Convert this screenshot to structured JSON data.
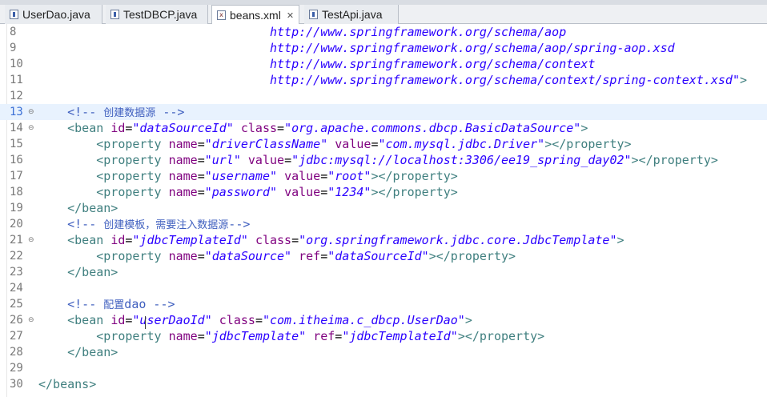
{
  "tabs": [
    {
      "label": "UserDao.java",
      "icon": "java-file-icon",
      "active": false
    },
    {
      "label": "TestDBCP.java",
      "icon": "java-file-icon",
      "active": false
    },
    {
      "label": "beans.xml",
      "icon": "xml-file-icon",
      "active": true,
      "close": "✕"
    },
    {
      "label": "TestApi.java",
      "icon": "java-file-icon",
      "active": false
    }
  ],
  "editor": {
    "lines": [
      {
        "n": "8",
        "fold": "",
        "seg": [
          [
            "t",
            "                                "
          ],
          [
            "v",
            "http://www.springframework.org/schema/aop"
          ]
        ]
      },
      {
        "n": "9",
        "fold": "",
        "seg": [
          [
            "t",
            "                                "
          ],
          [
            "v",
            "http://www.springframework.org/schema/aop/spring-aop.xsd"
          ]
        ]
      },
      {
        "n": "10",
        "fold": "",
        "seg": [
          [
            "t",
            "                                "
          ],
          [
            "v",
            "http://www.springframework.org/schema/context"
          ]
        ]
      },
      {
        "n": "11",
        "fold": "",
        "seg": [
          [
            "t",
            "                                "
          ],
          [
            "v",
            "http://www.springframework.org/schema/context/spring-context.xsd\""
          ],
          [
            "g",
            ">"
          ]
        ]
      },
      {
        "n": "12",
        "fold": "",
        "seg": []
      },
      {
        "n": "13",
        "fold": "⊖",
        "current": true,
        "seg": [
          [
            "t",
            "    "
          ],
          [
            "c",
            "<!-- "
          ],
          [
            "z",
            "创建数据源"
          ],
          [
            "c",
            " -->"
          ]
        ]
      },
      {
        "n": "14",
        "fold": "⊖",
        "seg": [
          [
            "t",
            "    "
          ],
          [
            "g",
            "<bean "
          ],
          [
            "a",
            "id"
          ],
          [
            "t",
            "="
          ],
          [
            "v",
            "\"dataSourceId\""
          ],
          [
            "t",
            " "
          ],
          [
            "a",
            "class"
          ],
          [
            "t",
            "="
          ],
          [
            "v",
            "\"org.apache.commons.dbcp.BasicDataSource\""
          ],
          [
            "g",
            ">"
          ]
        ]
      },
      {
        "n": "15",
        "fold": "",
        "seg": [
          [
            "t",
            "        "
          ],
          [
            "g",
            "<property "
          ],
          [
            "a",
            "name"
          ],
          [
            "t",
            "="
          ],
          [
            "v",
            "\"driverClassName\""
          ],
          [
            "t",
            " "
          ],
          [
            "a",
            "value"
          ],
          [
            "t",
            "="
          ],
          [
            "v",
            "\"com.mysql.jdbc.Driver\""
          ],
          [
            "g",
            "></property>"
          ]
        ]
      },
      {
        "n": "16",
        "fold": "",
        "seg": [
          [
            "t",
            "        "
          ],
          [
            "g",
            "<property "
          ],
          [
            "a",
            "name"
          ],
          [
            "t",
            "="
          ],
          [
            "v",
            "\"url\""
          ],
          [
            "t",
            " "
          ],
          [
            "a",
            "value"
          ],
          [
            "t",
            "="
          ],
          [
            "v",
            "\"jdbc:mysql://localhost:3306/ee19_spring_day02\""
          ],
          [
            "g",
            "></property>"
          ]
        ]
      },
      {
        "n": "17",
        "fold": "",
        "seg": [
          [
            "t",
            "        "
          ],
          [
            "g",
            "<property "
          ],
          [
            "a",
            "name"
          ],
          [
            "t",
            "="
          ],
          [
            "v",
            "\"username\""
          ],
          [
            "t",
            " "
          ],
          [
            "a",
            "value"
          ],
          [
            "t",
            "="
          ],
          [
            "v",
            "\"root\""
          ],
          [
            "g",
            "></property>"
          ]
        ]
      },
      {
        "n": "18",
        "fold": "",
        "seg": [
          [
            "t",
            "        "
          ],
          [
            "g",
            "<property "
          ],
          [
            "a",
            "name"
          ],
          [
            "t",
            "="
          ],
          [
            "v",
            "\"password\""
          ],
          [
            "t",
            " "
          ],
          [
            "a",
            "value"
          ],
          [
            "t",
            "="
          ],
          [
            "v",
            "\"1234\""
          ],
          [
            "g",
            "></property>"
          ]
        ]
      },
      {
        "n": "19",
        "fold": "",
        "seg": [
          [
            "t",
            "    "
          ],
          [
            "g",
            "</bean>"
          ]
        ]
      },
      {
        "n": "20",
        "fold": "",
        "seg": [
          [
            "t",
            "    "
          ],
          [
            "c",
            "<!-- "
          ],
          [
            "z",
            "创建模板，需要注入数据源"
          ],
          [
            "c",
            "-->"
          ]
        ]
      },
      {
        "n": "21",
        "fold": "⊖",
        "seg": [
          [
            "t",
            "    "
          ],
          [
            "g",
            "<bean "
          ],
          [
            "a",
            "id"
          ],
          [
            "t",
            "="
          ],
          [
            "v",
            "\"jdbcTemplateId\""
          ],
          [
            "t",
            " "
          ],
          [
            "a",
            "class"
          ],
          [
            "t",
            "="
          ],
          [
            "v",
            "\"org.springframework.jdbc.core.JdbcTemplate\""
          ],
          [
            "g",
            ">"
          ]
        ]
      },
      {
        "n": "22",
        "fold": "",
        "seg": [
          [
            "t",
            "        "
          ],
          [
            "g",
            "<property "
          ],
          [
            "a",
            "name"
          ],
          [
            "t",
            "="
          ],
          [
            "v",
            "\"dataSource\""
          ],
          [
            "t",
            " "
          ],
          [
            "a",
            "ref"
          ],
          [
            "t",
            "="
          ],
          [
            "v",
            "\"dataSourceId\""
          ],
          [
            "g",
            "></property>"
          ]
        ]
      },
      {
        "n": "23",
        "fold": "",
        "seg": [
          [
            "t",
            "    "
          ],
          [
            "g",
            "</bean>"
          ]
        ]
      },
      {
        "n": "24",
        "fold": "",
        "seg": []
      },
      {
        "n": "25",
        "fold": "",
        "seg": [
          [
            "t",
            "    "
          ],
          [
            "c",
            "<!-- "
          ],
          [
            "z",
            "配置"
          ],
          [
            "c",
            "dao -->"
          ]
        ]
      },
      {
        "n": "26",
        "fold": "⊖",
        "seg": [
          [
            "t",
            "    "
          ],
          [
            "g",
            "<bean "
          ],
          [
            "a",
            "id"
          ],
          [
            "t",
            "="
          ],
          [
            "v",
            "\"userDaoId\""
          ],
          [
            "t",
            " "
          ],
          [
            "a",
            "class"
          ],
          [
            "t",
            "="
          ],
          [
            "v",
            "\"com.itheima.c_dbcp.UserDao\""
          ],
          [
            "g",
            ">"
          ]
        ]
      },
      {
        "n": "27",
        "fold": "",
        "seg": [
          [
            "t",
            "        "
          ],
          [
            "g",
            "<property "
          ],
          [
            "a",
            "name"
          ],
          [
            "t",
            "="
          ],
          [
            "v",
            "\"jdbcTemplate\""
          ],
          [
            "t",
            " "
          ],
          [
            "a",
            "ref"
          ],
          [
            "t",
            "="
          ],
          [
            "v",
            "\"jdbcTemplateId\""
          ],
          [
            "g",
            "></property>"
          ]
        ]
      },
      {
        "n": "28",
        "fold": "",
        "seg": [
          [
            "t",
            "    "
          ],
          [
            "g",
            "</bean>"
          ]
        ]
      },
      {
        "n": "29",
        "fold": "",
        "seg": []
      },
      {
        "n": "30",
        "fold": "",
        "seg": [
          [
            "g",
            "</beans>"
          ]
        ]
      }
    ]
  }
}
